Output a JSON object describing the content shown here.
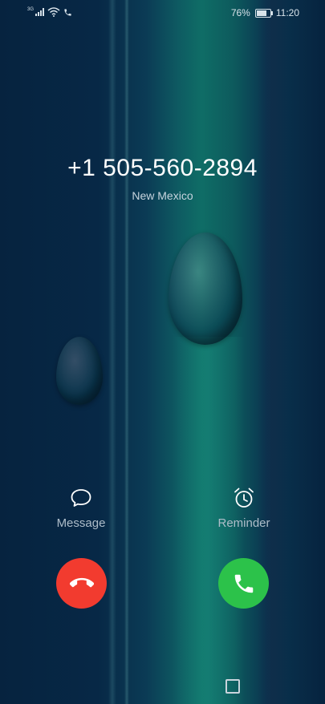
{
  "status_bar": {
    "network": "3G",
    "battery_percent": "76%",
    "battery_level": 0.76,
    "time": "11:20"
  },
  "caller": {
    "number": "+1 505-560-2894",
    "location": "New Mexico"
  },
  "actions": {
    "message_label": "Message",
    "reminder_label": "Reminder"
  },
  "icons": {
    "message": "speech-bubble-icon",
    "reminder": "alarm-clock-icon",
    "decline": "phone-hangup-icon",
    "answer": "phone-icon",
    "recent_apps": "square-icon"
  },
  "colors": {
    "decline": "#f23b2f",
    "answer": "#2cc24a"
  }
}
